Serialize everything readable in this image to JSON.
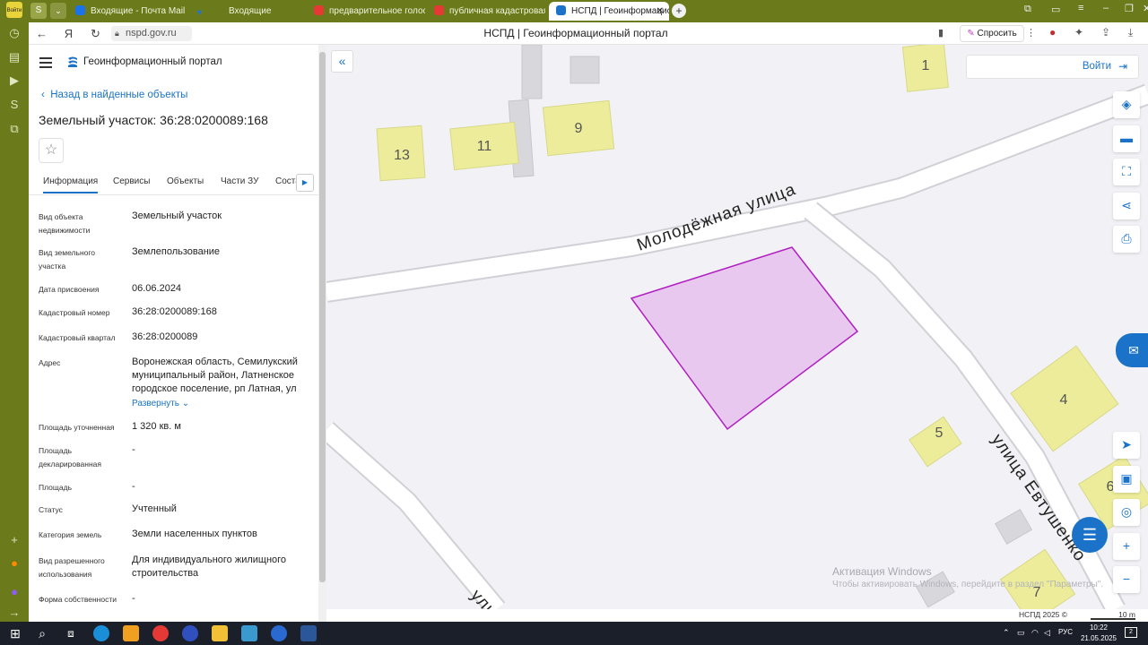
{
  "browser": {
    "tabs": [
      {
        "label": "Входящие - Почта Mail",
        "color": "#1a73e8"
      },
      {
        "label": "Входящие",
        "color": "#1a73e8"
      },
      {
        "label": "предварительное голосо",
        "color": "#e53935"
      },
      {
        "label": "публичная кадастровая",
        "color": "#e53935"
      },
      {
        "label": "НСПД | Геоинформацис",
        "color": "#1a73c8",
        "active": true
      }
    ],
    "url": "nspd.gov.ru",
    "page_title": "НСПД | Геоинформационный портал",
    "ask_label": "Спросить",
    "login_badge": "Войти"
  },
  "panel": {
    "brand": "Геоинформационный портал",
    "back_link": "Назад в найденные объекты",
    "object_title": "Земельный участок: 36:28:0200089:168",
    "tabs": [
      "Информация",
      "Сервисы",
      "Объекты",
      "Части ЗУ",
      "Соста"
    ],
    "active_tab": "Информация",
    "fields": [
      {
        "label": "Вид объекта недвижимости",
        "value": "Земельный участок"
      },
      {
        "label": "Вид земельного участка",
        "value": "Землепользование"
      },
      {
        "label": "Дата присвоения",
        "value": "06.06.2024"
      },
      {
        "label": "Кадастровый номер",
        "value": "36:28:0200089:168"
      },
      {
        "label": "Кадастровый квартал",
        "value": "36:28:0200089"
      },
      {
        "label": "Адрес",
        "value": "Воронежская область, Семилукский муниципальный район, Латненское городское поселение, рп Латная, ул"
      },
      {
        "label": "Площадь уточненная",
        "value": "1 320 кв. м"
      },
      {
        "label": "Площадь декларированная",
        "value": "-"
      },
      {
        "label": "Площадь",
        "value": "-"
      },
      {
        "label": "Статус",
        "value": "Учтенный"
      },
      {
        "label": "Категория земель",
        "value": "Земли населенных пунктов"
      },
      {
        "label": "Вид разрешенного использования",
        "value": "Для индивидуального жилищного строительства"
      },
      {
        "label": "Форма собственности",
        "value": "-"
      }
    ],
    "expand_label": "Развернуть"
  },
  "map": {
    "login_label": "Войти",
    "streets": [
      "Молодёжная улица",
      "улица Евтушенко",
      "ули"
    ],
    "house_numbers": [
      "1",
      "13",
      "11",
      "9",
      "4",
      "5",
      "6",
      "7"
    ],
    "watermark_title": "Активация Windows",
    "watermark_text": "Чтобы активировать Windows, перейдите в раздел \"Параметры\".",
    "copyright": "НСПД 2025 ©",
    "scale": "10 m",
    "parcel_fill": "#e8c8ef",
    "parcel_stroke": "#b020c0",
    "building_fill": "#ecec9a",
    "road_fill": "#ffffff",
    "road_edge": "#d0d0d6"
  },
  "taskbar": {
    "lang": "РУС",
    "time": "10:22",
    "date": "21.05.2025",
    "notifications": "2"
  }
}
